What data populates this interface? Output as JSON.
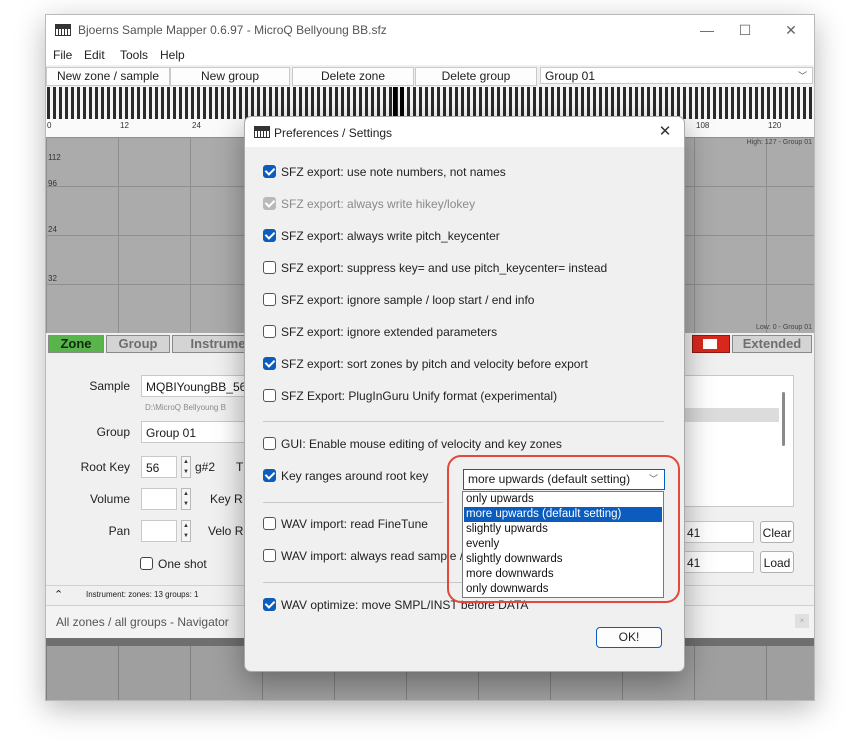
{
  "window": {
    "title": "Bjoerns Sample Mapper 0.6.97 - MicroQ Bellyoung BB.sfz",
    "minimize": "—",
    "maximize": "☐",
    "close": "✕"
  },
  "menu": [
    "File",
    "Edit",
    "Tools",
    "Help"
  ],
  "toolbar": {
    "new_zone": "New zone / sample",
    "new_group": "New group",
    "delete_zone": "Delete zone",
    "delete_group": "Delete group",
    "group_select": "Group 01"
  },
  "keyboard": {
    "labels": [
      "0",
      "12",
      "24",
      "108",
      "120"
    ]
  },
  "map": {
    "velocity_labels": [
      "112",
      "96",
      "24",
      "32"
    ],
    "high_info": "High: 127 - Group 01",
    "low_info": "Low: 0 - Group 01"
  },
  "tabs": {
    "zone": "Zone",
    "group": "Group",
    "instrument": "Instrume",
    "extended": "Extended"
  },
  "zone_panel": {
    "sample_label": "Sample",
    "sample_value": "MQBIYoungBB_56.",
    "sample_path": "D:\\MicroQ Bellyoung B",
    "group_label": "Group",
    "group_value": "Group 01",
    "root_key_label": "Root Key",
    "root_key_value": "56",
    "root_key_note": "g#2",
    "root_key_cut": "T",
    "volume_label": "Volume",
    "key_range_cut": "Key R",
    "pan_label": "Pan",
    "velo_range_cut": "Velo R",
    "one_shot": "One shot",
    "field_a": "41",
    "field_b": "41",
    "clear": "Clear",
    "load": "Load"
  },
  "status": {
    "expand": "⌃",
    "text": "Instrument:  zones: 13   groups: 1"
  },
  "navigator": {
    "title": "All zones / all groups - Navigator",
    "close": "×"
  },
  "dialog": {
    "title": "Preferences / Settings",
    "close": "✕",
    "options": [
      {
        "label": "SFZ export: use note numbers, not names",
        "state": "checked"
      },
      {
        "label": "SFZ export: always write hikey/lokey",
        "state": "disabled"
      },
      {
        "label": "SFZ export: always write pitch_keycenter",
        "state": "checked"
      },
      {
        "label": "SFZ export: suppress key= and use pitch_keycenter= instead",
        "state": "unchecked"
      },
      {
        "label": "SFZ export: ignore sample / loop start / end info",
        "state": "unchecked"
      },
      {
        "label": "SFZ export: ignore extended parameters",
        "state": "unchecked"
      },
      {
        "label": "SFZ export: sort zones by pitch and velocity before export",
        "state": "checked"
      },
      {
        "label": "SFZ Export: PlugInGuru Unify format (experimental)",
        "state": "unchecked"
      },
      {
        "label": "GUI: Enable mouse editing of velocity and key zones",
        "state": "unchecked"
      },
      {
        "label": "Key ranges around root key",
        "state": "checked"
      },
      {
        "label": "WAV import: read FineTune",
        "state": "unchecked"
      },
      {
        "label": "WAV import: always read sample /",
        "state": "unchecked"
      },
      {
        "label": "WAV optimize: move SMPL/INST before DATA",
        "state": "checked"
      }
    ],
    "combo_value": "more upwards (default setting)",
    "dropdown": [
      "only upwards",
      "more upwards (default setting)",
      "slightly upwards",
      "evenly",
      "slightly downwards",
      "more downwards",
      "only downwards"
    ],
    "dropdown_selected": 1,
    "ok": "OK!"
  },
  "colors": {
    "accent": "#0b5cbd",
    "zone_tab": "#59b44c",
    "red_tab": "#d8281e",
    "highlight": "#e2483b"
  }
}
